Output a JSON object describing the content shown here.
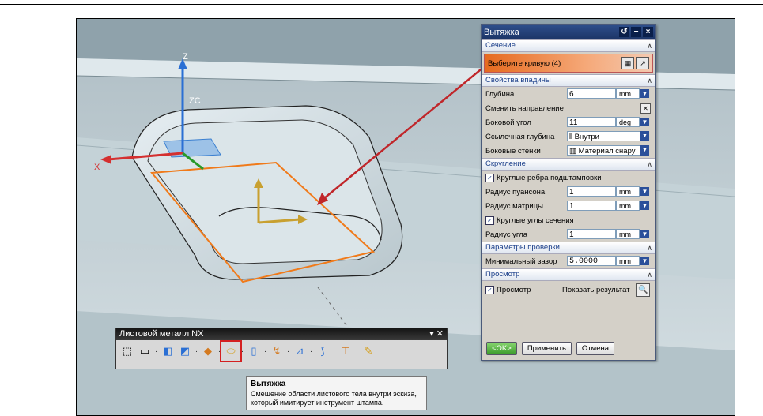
{
  "axes": {
    "z": "Z",
    "zc": "ZC",
    "x": "X"
  },
  "dialog": {
    "title": "Вытяжка",
    "section_section": "Сечение",
    "select_curve": "Выберите кривую (4)",
    "section_props": "Свойства впадины",
    "depth_label": "Глубина",
    "depth_value": "6",
    "depth_unit": "mm",
    "reverse_label": "Сменить направление",
    "side_angle_label": "Боковой угол",
    "side_angle_value": "11",
    "side_angle_unit": "deg",
    "ref_depth_label": "Ссылочная глубина",
    "ref_depth_value": "Внутри",
    "side_walls_label": "Боковые стенки",
    "side_walls_value": "Материал снару",
    "section_round": "Скругление",
    "round_punch_edges": "Круглые ребра подштамповки",
    "punch_radius_label": "Радиус пуансона",
    "punch_radius_value": "1",
    "punch_radius_unit": "mm",
    "die_radius_label": "Радиус матрицы",
    "die_radius_value": "1",
    "die_radius_unit": "mm",
    "round_section_corners": "Круглые углы сечения",
    "corner_radius_label": "Радиус угла",
    "corner_radius_value": "1",
    "corner_radius_unit": "mm",
    "section_check": "Параметры проверки",
    "min_gap_label": "Минимальный зазор",
    "min_gap_value": "5.0000",
    "min_gap_unit": "mm",
    "section_preview": "Просмотр",
    "preview_label": "Просмотр",
    "show_result_label": "Показать результат",
    "ok": "<OK>",
    "apply": "Применить",
    "cancel": "Отмена"
  },
  "toolbar": {
    "title": "Листовой металл NX"
  },
  "tooltip": {
    "title": "Вытяжка",
    "text": "Смещение области листового тела внутри эскиза, который имитирует инструмент штампа."
  }
}
